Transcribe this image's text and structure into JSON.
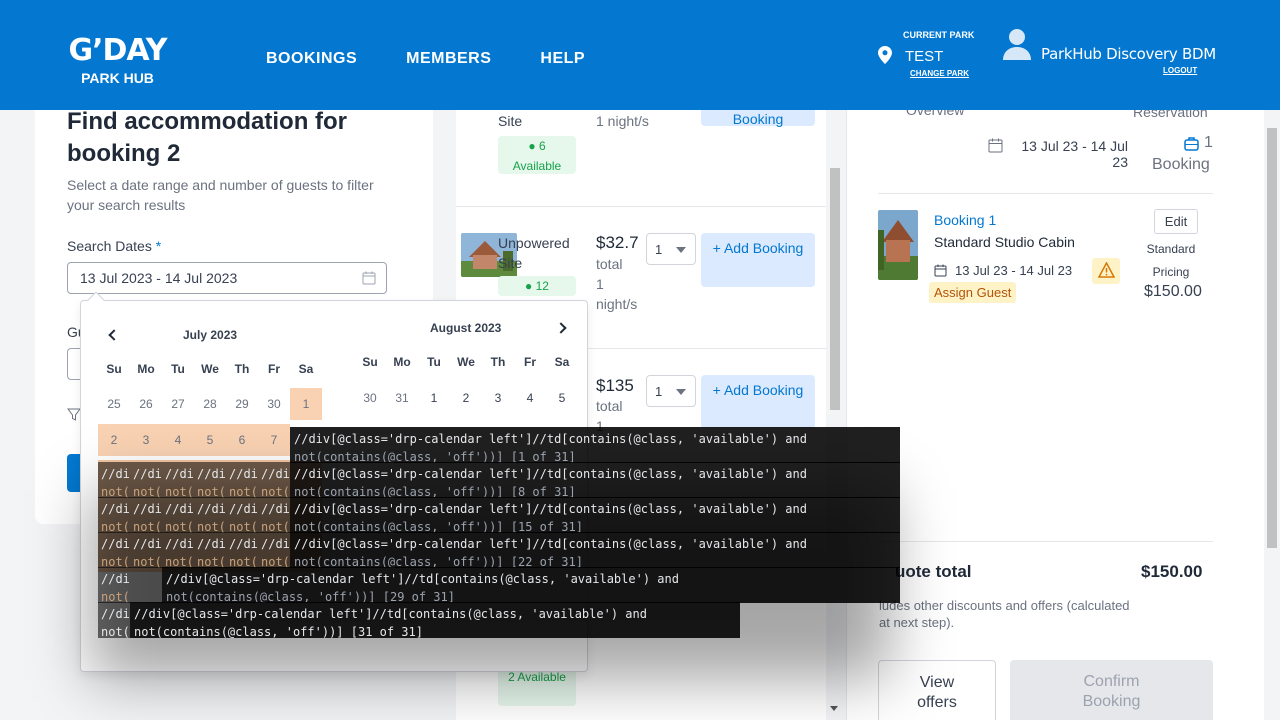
{
  "header": {
    "logo_main": "G’DAY",
    "logo_sub": "PARK HUB",
    "nav": [
      "BOOKINGS",
      "MEMBERS",
      "HELP"
    ],
    "current_park_label": "CURRENT PARK",
    "park_name": "TEST",
    "change_park": "CHANGE PARK",
    "user_name": "ParkHub Discovery BDM",
    "logout": "LOGOUT",
    "colors": {
      "brand": "#0478d0"
    }
  },
  "search": {
    "title": "Find accommodation for booking 2",
    "subtitle": "Select a date range and number of guests to filter your search results",
    "dates_label": "Search Dates",
    "required_marker": "*",
    "dates_value": "13 Jul 2023 - 14 Jul 2023",
    "guests_label_fragment": "Gu"
  },
  "calendar": {
    "left_month": "July 2023",
    "right_month": "August 2023",
    "weekdays": [
      "Su",
      "Mo",
      "Tu",
      "We",
      "Th",
      "Fr",
      "Sa"
    ],
    "left_row1": [
      "25",
      "26",
      "27",
      "28",
      "29",
      "30",
      "1"
    ],
    "left_row2": [
      "2",
      "3",
      "4",
      "5",
      "6",
      "7"
    ],
    "right_row1": [
      "30",
      "31",
      "1",
      "2",
      "3",
      "4",
      "5"
    ]
  },
  "results": [
    {
      "name": "Site",
      "available": "6 Available",
      "price_sub": "1 night/s",
      "add_label": "Booking"
    },
    {
      "name": "Unpowered Site",
      "available": "12",
      "price": "$32.7",
      "price_unit": "total",
      "price_sub": "1 night/s",
      "qty": "1",
      "add_label": "+ Add Booking"
    },
    {
      "price": "$135",
      "price_unit": "total",
      "price_sub": "1",
      "qty": "1",
      "add_label": "+ Add Booking"
    },
    {
      "available": "2 Available"
    }
  ],
  "summary": {
    "overview_label": "Overview",
    "reservation_label": "Reservation",
    "overview_dates": "13 Jul 23 - 14 Jul 23",
    "booking_count": "1",
    "booking_count_label": "Booking",
    "booking": {
      "title": "Booking 1",
      "type": "Standard Studio Cabin",
      "dates": "13 Jul 23 - 14 Jul 23",
      "assign": "Assign Guest",
      "edit": "Edit",
      "pricing": "Standard Pricing",
      "price": "$150.00"
    },
    "quote_label": "uote total",
    "quote_total": "$150.00",
    "quote_note": "ludes other discounts and offers (calculated at next step).",
    "view_offers": "View offers",
    "confirm": "Confirm Booking"
  },
  "devtools": {
    "xpath_head": "//div[@class='drp-calendar left']//td[contains(@class, 'available') and",
    "xpath_head_short": "//div[@class='drp-calendar left']//td[contains(@class, 'available') and",
    "tail_1": "not(contains(@class, 'off'))] [1 of 31]",
    "tail_8": "not(contains(@class, 'off'))] [8 of 31]",
    "tail_15": "not(contains(@class, 'off'))] [15 of 31]",
    "tail_22": "not(contains(@class, 'off'))] [22 of 31]",
    "tail_29": "not(contains(@class, 'off'))] [29 of 31]",
    "tail_31": "not(contains(@class, 'off'))] [31 of 31]",
    "frag_top": "//di",
    "frag_bot": "not(",
    "frag_tail_short": "not(contains(@class, 'off'))] [31 of 31]",
    "row5_head": "//div[@class='drp-calendar left']//td[contains(@class, 'available') and",
    "last_head": "//div[@class='drp-calendar left']//td[contains(@class, 'available') and",
    "last_tail": "not(contains(@class, 'off'))] [31 of 31]"
  }
}
